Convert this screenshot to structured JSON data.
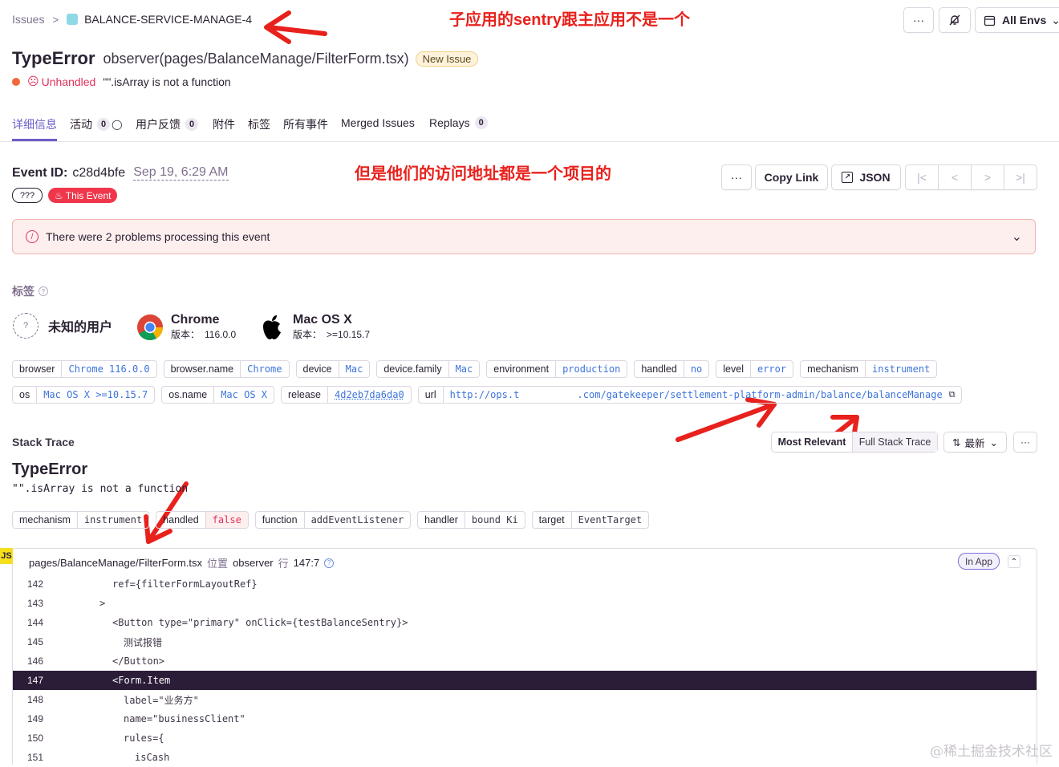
{
  "breadcrumb": {
    "root": "Issues",
    "project": "BALANCE-SERVICE-MANAGE-4"
  },
  "annotations": {
    "top": "子应用的sentry跟主应用不是一个",
    "middle": "但是他们的访问地址都是一个项目的"
  },
  "header_actions": {
    "more": "···",
    "envs": "All Envs"
  },
  "issue": {
    "type": "TypeError",
    "location": "observer(pages/BalanceManage/FilterForm.tsx)",
    "badge": "New Issue",
    "unhandled": "Unhandled",
    "message": "\"\".isArray is not a function"
  },
  "tabs": [
    {
      "label": "详细信息",
      "count": ""
    },
    {
      "label": "活动",
      "count": "0"
    },
    {
      "label": "用户反馈",
      "count": "0"
    },
    {
      "label": "附件",
      "count": ""
    },
    {
      "label": "标签",
      "count": ""
    },
    {
      "label": "所有事件",
      "count": ""
    },
    {
      "label": "Merged Issues",
      "count": ""
    },
    {
      "label": "Replays",
      "count": "0"
    }
  ],
  "event": {
    "id_label": "Event ID:",
    "id": "c28d4bfe",
    "date": "Sep 19, 6:29 AM",
    "pill": "???",
    "this_event": "This Event",
    "more": "···",
    "copy_link": "Copy Link",
    "json": "JSON"
  },
  "alert": {
    "text": "There were 2 problems processing this event"
  },
  "tags_section": {
    "title": "标签",
    "user": "未知的用户",
    "browser": {
      "name": "Chrome",
      "version_label": "版本：",
      "version": "116.0.0"
    },
    "os": {
      "name": "Mac OS X",
      "version_label": "版本：",
      "version": ">=10.15.7"
    },
    "row1": [
      {
        "k": "browser",
        "v": "Chrome 116.0.0"
      },
      {
        "k": "browser.name",
        "v": "Chrome"
      },
      {
        "k": "device",
        "v": "Mac"
      },
      {
        "k": "device.family",
        "v": "Mac"
      },
      {
        "k": "environment",
        "v": "production"
      },
      {
        "k": "handled",
        "v": "no"
      },
      {
        "k": "level",
        "v": "error"
      },
      {
        "k": "mechanism",
        "v": "instrument"
      }
    ],
    "row2": [
      {
        "k": "os",
        "v": "Mac OS X >=10.15.7"
      },
      {
        "k": "os.name",
        "v": "Mac OS X"
      },
      {
        "k": "release",
        "v": "4d2eb7da6da0"
      },
      {
        "k": "url",
        "v": "http://ops.t          .com/gatekeeper/settlement-platform-admin/balance/balanceManage"
      }
    ]
  },
  "stack": {
    "title": "Stack Trace",
    "most_relevant": "Most Relevant",
    "full": "Full Stack Trace",
    "sort": "最新",
    "more": "···",
    "exc_type": "TypeError",
    "exc_value": "\"\".isArray is not a function",
    "mech_tags": [
      {
        "k": "mechanism",
        "v": "instrument"
      },
      {
        "k": "handled",
        "v": "false"
      },
      {
        "k": "function",
        "v": "addEventListener"
      },
      {
        "k": "handler",
        "v": "bound Ki"
      },
      {
        "k": "target",
        "v": "EventTarget"
      }
    ],
    "frame": {
      "lang": "JS",
      "file": "pages/BalanceManage/FilterForm.tsx",
      "at": "位置",
      "func": "observer",
      "line_label": "行",
      "line": "147:7",
      "in_app": "In App"
    },
    "lines": [
      {
        "n": "142",
        "code": "ref={filterFormLayoutRef}",
        "indent": 1
      },
      {
        "n": "143",
        "code": ">",
        "indent": 0
      },
      {
        "n": "144",
        "code": "<Button type=\"primary\" onClick={testBalanceSentry}>",
        "indent": 1
      },
      {
        "n": "145",
        "code": "测试报错",
        "indent": 2
      },
      {
        "n": "146",
        "code": "</Button>",
        "indent": 1
      },
      {
        "n": "147",
        "code": "<Form.Item",
        "indent": 1
      },
      {
        "n": "148",
        "code": "label=\"业务方\"",
        "indent": 2
      },
      {
        "n": "149",
        "code": "name=\"businessClient\"",
        "indent": 2
      },
      {
        "n": "150",
        "code": "rules={",
        "indent": 2
      },
      {
        "n": "151",
        "code": "isCash",
        "indent": 3
      }
    ]
  },
  "watermark": "@稀土掘金技术社区"
}
